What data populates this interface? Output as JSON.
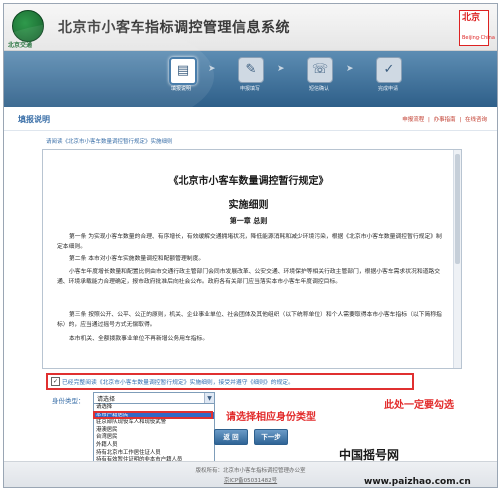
{
  "header": {
    "logo_text": "北京交通",
    "title": "北京市小客车指标调控管理信息系统",
    "badge_line1": "北京",
    "badge_line2": "Beijing·China"
  },
  "steps": [
    {
      "label": "填报说明",
      "icon": "document-icon",
      "active": true
    },
    {
      "label": "申报填写",
      "icon": "form-icon",
      "active": false
    },
    {
      "label": "短信确认",
      "icon": "phone-icon",
      "active": false
    },
    {
      "label": "完成申请",
      "icon": "check-icon",
      "active": false
    }
  ],
  "subbar": {
    "title": "填报说明",
    "links": [
      "申报流程",
      "办事指南",
      "在线咨询"
    ]
  },
  "breadcrumb": "请阅读《北京市小客车数量调控暂行规定》实施细则",
  "document": {
    "title": "《北京市小客车数量调控暂行规定》",
    "subtitle": "实施细则",
    "chapter": "第一章 总则",
    "paragraphs": [
      "第一条 为实现小客车数量的合理、有序增长，有效缓解交通拥堵状况，降低能源消耗和减少环境污染，根据《北京市小客车数量调控暂行规定》制定本细则。",
      "第二条 本市对小客车实施数量调控和配额管理制度。",
      "小客车年度增长数量和配置比例由市交通行政主管部门会同市发展改革、公安交通、环境保护等相关行政主管部门，根据小客车需求状况和道路交通、环境承载能力合理确定，报市政府批准后向社会公布。政府各有关部门应当落实本市小客车年度调控目标。",
      "第三条 按照公开、公平、公正的原则，机关、企业事业单位、社会团体及其他组织（以下统称单位）和个人需要取得本市小客车指标（以下简称指标）的，应当通过摇号方式无偿取得。",
      "本市机关、全额拨款事业单位不再新增公务用车指标。"
    ]
  },
  "agree": {
    "checked": true,
    "text": "已经完整阅读《北京市小客车数量调控暂行规定》实施细则，接受并遵守《细则》的规定。"
  },
  "identity": {
    "label": "身份类型：",
    "selected": "请选择",
    "options": [
      "请选择",
      "本市户籍居民",
      "驻京部队现役军人和现役武警",
      "港澳居民",
      "台湾居民",
      "外籍人员",
      "持有北京市工作居住证人员",
      "持有有效暂住证明的非本市户籍人员"
    ],
    "highlighted_index": 1
  },
  "notes": {
    "select_hint": "请选择相应身份类型",
    "check_hint": "此处一定要勾选"
  },
  "buttons": {
    "back": "返 回",
    "next": "下一步"
  },
  "footer": {
    "copyright": "版权所有：北京市小客车指标调控管理办公室",
    "icp": "京ICP备05031482号"
  },
  "watermark": {
    "line1": "中国摇号网",
    "line2": "www.paizhao.com.cn"
  },
  "colors": {
    "accent_blue": "#3a6fa8",
    "annotation_red": "#e22a2a",
    "nav_bar": "#2e5f89"
  }
}
